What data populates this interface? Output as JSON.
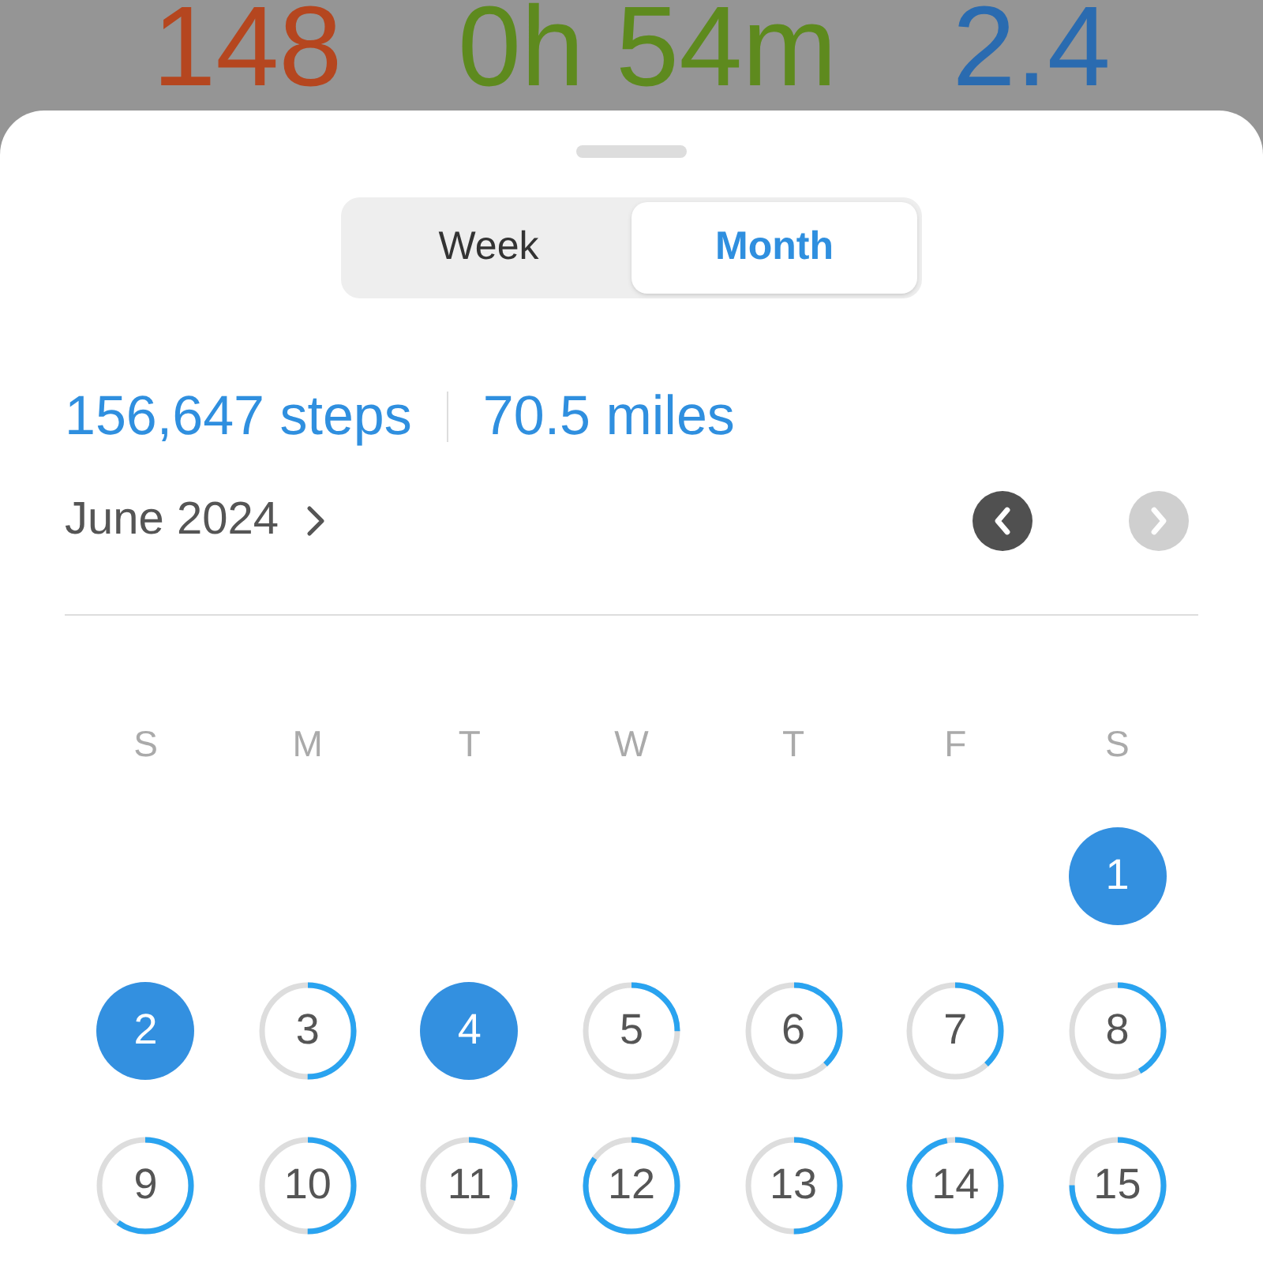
{
  "background_stats": [
    {
      "value": "148",
      "color": "#b5461f"
    },
    {
      "value": "0h 54m",
      "color": "#5e8a1e"
    },
    {
      "value": "2.4",
      "color": "#2a6bb0"
    }
  ],
  "segments": [
    {
      "label": "Week",
      "selected": false
    },
    {
      "label": "Month",
      "selected": true
    }
  ],
  "summary": {
    "steps": "156,647 steps",
    "distance": "70.5 miles"
  },
  "period": {
    "label": "June 2024",
    "prev_disabled": false,
    "next_disabled": true
  },
  "weekdays": [
    "S",
    "M",
    "T",
    "W",
    "T",
    "F",
    "S"
  ],
  "weeks": [
    {
      "days": [
        {
          "day": "1",
          "goal_met": true
        }
      ]
    },
    {
      "days": [
        {
          "day": "2",
          "goal_met": true
        },
        {
          "day": "3",
          "level": 0.5
        },
        {
          "day": "4",
          "goal_met": true
        },
        {
          "day": "5",
          "level": 0.25
        },
        {
          "day": "6",
          "level": 0.38
        },
        {
          "day": "7",
          "level": 0.38
        },
        {
          "day": "8",
          "level": 0.42
        }
      ]
    },
    {
      "days": [
        {
          "day": "9",
          "level": 0.6
        },
        {
          "day": "10",
          "level": 0.5
        },
        {
          "day": "11",
          "level": 0.3
        },
        {
          "day": "12",
          "level": 0.85
        },
        {
          "day": "13",
          "level": 0.5
        },
        {
          "day": "14",
          "level": 0.97
        },
        {
          "day": "15",
          "level": 0.75
        }
      ]
    }
  ]
}
